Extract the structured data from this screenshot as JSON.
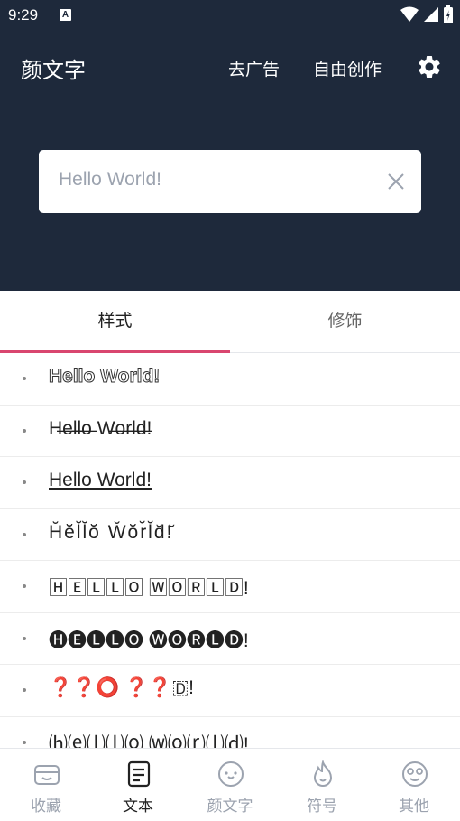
{
  "status_bar": {
    "time": "9:29",
    "app_badge": "A"
  },
  "app_bar": {
    "title": "颜文字",
    "actions": [
      "去广告",
      "自由创作"
    ],
    "settings_icon": "gear-icon"
  },
  "input": {
    "value": "Hello World!",
    "clear_icon": "close-icon"
  },
  "tabs": [
    {
      "label": "样式",
      "active": true
    },
    {
      "label": "修饰",
      "active": false
    }
  ],
  "styles": [
    {
      "text": "Hello World!"
    },
    {
      "text": "H̶e̶l̶l̶o̶ W̶o̶r̶l̶d̶!"
    },
    {
      "text": "Hello World!"
    },
    {
      "text": "H̆ĕl̆l̆ŏ W̆ŏr̆l̆d̆!̆"
    },
    {
      "text": "🄷🄴🄻🄻🄾 🅆🄾🅁🄻🄳!"
    },
    {
      "text": "🅗🅔🅛🅛🅞 🅦🅞🅡🅛🅓!"
    },
    {
      "text": "❓❓⭕ ❓❓🇩!"
    },
    {
      "text": "⒣⒠⒧⒧⒪ ⒲⒪⒭⒧⒟!"
    }
  ],
  "bottom_nav": [
    {
      "label": "收藏",
      "icon": "favorites-box-icon",
      "active": false
    },
    {
      "label": "文本",
      "icon": "text-note-icon",
      "active": true
    },
    {
      "label": "颜文字",
      "icon": "kaomoji-face-icon",
      "active": false
    },
    {
      "label": "符号",
      "icon": "flame-icon",
      "active": false
    },
    {
      "label": "其他",
      "icon": "smiley-face-icon",
      "active": false
    }
  ],
  "colors": {
    "header_bg": "#1e293b",
    "accent": "#d9466f"
  }
}
